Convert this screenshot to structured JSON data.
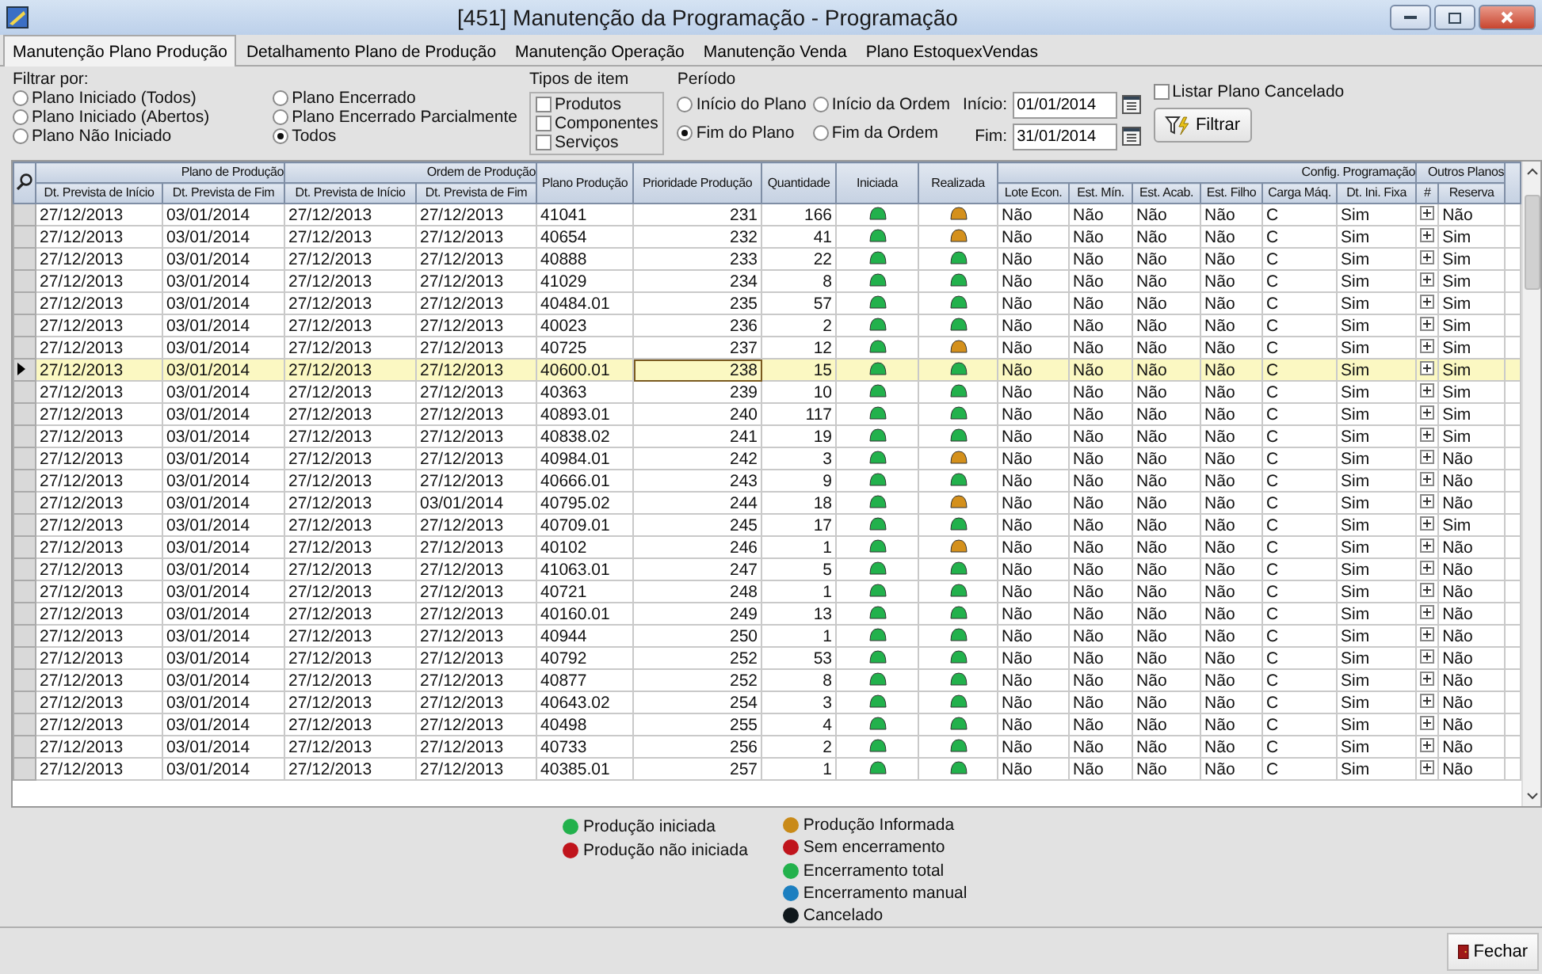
{
  "window": {
    "title": "[451] Manutenção da Programação - Programação"
  },
  "tabs": [
    {
      "label": "Manutenção Plano Produção",
      "selected": true
    },
    {
      "label": "Detalhamento Plano de Produção",
      "selected": false
    },
    {
      "label": "Manutenção Operação",
      "selected": false
    },
    {
      "label": "Manutenção Venda",
      "selected": false
    },
    {
      "label": "Plano EstoquexVendas",
      "selected": false
    }
  ],
  "filter": {
    "label": "Filtrar por:",
    "options": [
      {
        "label": "Plano Iniciado (Todos)",
        "selected": false
      },
      {
        "label": "Plano Iniciado (Abertos)",
        "selected": false
      },
      {
        "label": "Plano Não Iniciado",
        "selected": false
      },
      {
        "label": "Plano Encerrado",
        "selected": false
      },
      {
        "label": "Plano Encerrado Parcialmente",
        "selected": false
      },
      {
        "label": "Todos",
        "selected": true
      }
    ]
  },
  "item_types": {
    "label": "Tipos de item",
    "items": [
      {
        "label": "Produtos",
        "checked": false
      },
      {
        "label": "Componentes",
        "checked": false
      },
      {
        "label": "Serviços",
        "checked": false
      }
    ]
  },
  "period": {
    "label": "Período",
    "options": [
      {
        "label": "Início do Plano",
        "selected": false
      },
      {
        "label": "Início da Ordem",
        "selected": false
      },
      {
        "label": "Fim do Plano",
        "selected": true
      },
      {
        "label": "Fim da Ordem",
        "selected": false
      }
    ]
  },
  "start": {
    "label": "Início:",
    "value": "01/01/2014"
  },
  "end": {
    "label": "Fim:",
    "value": "31/01/2014"
  },
  "list_cancelled": {
    "label": "Listar Plano Cancelado",
    "checked": false
  },
  "filter_button": "Filtrar",
  "table": {
    "header": [
      {
        "label": "Plano de Produção",
        "columns": [
          "Dt. Prevista de Início",
          "Dt. Prevista de Fim"
        ]
      },
      {
        "label": "Ordem de Produção",
        "columns": [
          "Dt. Prevista de Início",
          "Dt. Prevista de Fim"
        ]
      },
      {
        "label": "Plano Produção"
      },
      {
        "label": "Prioridade Produção"
      },
      {
        "label": "Quantidade"
      },
      {
        "label": "Iniciada"
      },
      {
        "label": "Realizada"
      },
      {
        "label": "Config. Programação",
        "columns": [
          "Lote Econ.",
          "Est. Mín.",
          "Est. Acab.",
          "Est. Filho",
          "Carga Máq.",
          "Dt. Ini. Fixa"
        ]
      },
      {
        "label": "Outros Planos",
        "columns": [
          "#",
          "Reserva"
        ]
      }
    ],
    "rows": [
      {
        "selected": false,
        "cells": [
          "27/12/2013",
          "03/01/2014",
          "27/12/2013",
          "27/12/2013",
          "41041",
          "231",
          "166"
        ],
        "iniciada": {
          "color": "#22b14c"
        },
        "realizada": {
          "color": "#d4901c"
        },
        "config": [
          "Não",
          "Não",
          "Não",
          "Não",
          "C",
          "Sim"
        ],
        "reserva": "Não"
      },
      {
        "selected": false,
        "cells": [
          "27/12/2013",
          "03/01/2014",
          "27/12/2013",
          "27/12/2013",
          "40654",
          "232",
          "41"
        ],
        "iniciada": {
          "color": "#22b14c"
        },
        "realizada": {
          "color": "#d4901c"
        },
        "config": [
          "Não",
          "Não",
          "Não",
          "Não",
          "C",
          "Sim"
        ],
        "reserva": "Sim"
      },
      {
        "selected": false,
        "cells": [
          "27/12/2013",
          "03/01/2014",
          "27/12/2013",
          "27/12/2013",
          "40888",
          "233",
          "22"
        ],
        "iniciada": {
          "color": "#22b14c"
        },
        "realizada": {
          "color": "#22b14c"
        },
        "config": [
          "Não",
          "Não",
          "Não",
          "Não",
          "C",
          "Sim"
        ],
        "reserva": "Sim"
      },
      {
        "selected": false,
        "cells": [
          "27/12/2013",
          "03/01/2014",
          "27/12/2013",
          "27/12/2013",
          "41029",
          "234",
          "8"
        ],
        "iniciada": {
          "color": "#22b14c"
        },
        "realizada": {
          "color": "#22b14c"
        },
        "config": [
          "Não",
          "Não",
          "Não",
          "Não",
          "C",
          "Sim"
        ],
        "reserva": "Sim"
      },
      {
        "selected": false,
        "cells": [
          "27/12/2013",
          "03/01/2014",
          "27/12/2013",
          "27/12/2013",
          "40484.01",
          "235",
          "57"
        ],
        "iniciada": {
          "color": "#22b14c"
        },
        "realizada": {
          "color": "#22b14c"
        },
        "config": [
          "Não",
          "Não",
          "Não",
          "Não",
          "C",
          "Sim"
        ],
        "reserva": "Sim"
      },
      {
        "selected": false,
        "cells": [
          "27/12/2013",
          "03/01/2014",
          "27/12/2013",
          "27/12/2013",
          "40023",
          "236",
          "2"
        ],
        "iniciada": {
          "color": "#22b14c"
        },
        "realizada": {
          "color": "#22b14c"
        },
        "config": [
          "Não",
          "Não",
          "Não",
          "Não",
          "C",
          "Sim"
        ],
        "reserva": "Sim"
      },
      {
        "selected": false,
        "cells": [
          "27/12/2013",
          "03/01/2014",
          "27/12/2013",
          "27/12/2013",
          "40725",
          "237",
          "12"
        ],
        "iniciada": {
          "color": "#22b14c"
        },
        "realizada": {
          "color": "#d4901c"
        },
        "config": [
          "Não",
          "Não",
          "Não",
          "Não",
          "C",
          "Sim"
        ],
        "reserva": "Sim"
      },
      {
        "selected": true,
        "cells": [
          "27/12/2013",
          "03/01/2014",
          "27/12/2013",
          "27/12/2013",
          "40600.01",
          "238",
          "15"
        ],
        "iniciada": {
          "color": "#22b14c"
        },
        "realizada": {
          "color": "#22b14c"
        },
        "config": [
          "Não",
          "Não",
          "Não",
          "Não",
          "C",
          "Sim"
        ],
        "reserva": "Sim"
      },
      {
        "selected": false,
        "cells": [
          "27/12/2013",
          "03/01/2014",
          "27/12/2013",
          "27/12/2013",
          "40363",
          "239",
          "10"
        ],
        "iniciada": {
          "color": "#22b14c"
        },
        "realizada": {
          "color": "#22b14c"
        },
        "config": [
          "Não",
          "Não",
          "Não",
          "Não",
          "C",
          "Sim"
        ],
        "reserva": "Sim"
      },
      {
        "selected": false,
        "cells": [
          "27/12/2013",
          "03/01/2014",
          "27/12/2013",
          "27/12/2013",
          "40893.01",
          "240",
          "117"
        ],
        "iniciada": {
          "color": "#22b14c"
        },
        "realizada": {
          "color": "#22b14c"
        },
        "config": [
          "Não",
          "Não",
          "Não",
          "Não",
          "C",
          "Sim"
        ],
        "reserva": "Sim"
      },
      {
        "selected": false,
        "cells": [
          "27/12/2013",
          "03/01/2014",
          "27/12/2013",
          "27/12/2013",
          "40838.02",
          "241",
          "19"
        ],
        "iniciada": {
          "color": "#22b14c"
        },
        "realizada": {
          "color": "#22b14c"
        },
        "config": [
          "Não",
          "Não",
          "Não",
          "Não",
          "C",
          "Sim"
        ],
        "reserva": "Sim"
      },
      {
        "selected": false,
        "cells": [
          "27/12/2013",
          "03/01/2014",
          "27/12/2013",
          "27/12/2013",
          "40984.01",
          "242",
          "3"
        ],
        "iniciada": {
          "color": "#22b14c"
        },
        "realizada": {
          "color": "#d4901c"
        },
        "config": [
          "Não",
          "Não",
          "Não",
          "Não",
          "C",
          "Sim"
        ],
        "reserva": "Não"
      },
      {
        "selected": false,
        "cells": [
          "27/12/2013",
          "03/01/2014",
          "27/12/2013",
          "27/12/2013",
          "40666.01",
          "243",
          "9"
        ],
        "iniciada": {
          "color": "#22b14c"
        },
        "realizada": {
          "color": "#22b14c"
        },
        "config": [
          "Não",
          "Não",
          "Não",
          "Não",
          "C",
          "Sim"
        ],
        "reserva": "Não"
      },
      {
        "selected": false,
        "cells": [
          "27/12/2013",
          "03/01/2014",
          "27/12/2013",
          "03/01/2014",
          "40795.02",
          "244",
          "18"
        ],
        "iniciada": {
          "color": "#22b14c"
        },
        "realizada": {
          "color": "#d4901c"
        },
        "config": [
          "Não",
          "Não",
          "Não",
          "Não",
          "C",
          "Sim"
        ],
        "reserva": "Não"
      },
      {
        "selected": false,
        "cells": [
          "27/12/2013",
          "03/01/2014",
          "27/12/2013",
          "27/12/2013",
          "40709.01",
          "245",
          "17"
        ],
        "iniciada": {
          "color": "#22b14c"
        },
        "realizada": {
          "color": "#22b14c"
        },
        "config": [
          "Não",
          "Não",
          "Não",
          "Não",
          "C",
          "Sim"
        ],
        "reserva": "Sim"
      },
      {
        "selected": false,
        "cells": [
          "27/12/2013",
          "03/01/2014",
          "27/12/2013",
          "27/12/2013",
          "40102",
          "246",
          "1"
        ],
        "iniciada": {
          "color": "#22b14c"
        },
        "realizada": {
          "color": "#d4901c"
        },
        "config": [
          "Não",
          "Não",
          "Não",
          "Não",
          "C",
          "Sim"
        ],
        "reserva": "Não"
      },
      {
        "selected": false,
        "cells": [
          "27/12/2013",
          "03/01/2014",
          "27/12/2013",
          "27/12/2013",
          "41063.01",
          "247",
          "5"
        ],
        "iniciada": {
          "color": "#22b14c"
        },
        "realizada": {
          "color": "#22b14c"
        },
        "config": [
          "Não",
          "Não",
          "Não",
          "Não",
          "C",
          "Sim"
        ],
        "reserva": "Não"
      },
      {
        "selected": false,
        "cells": [
          "27/12/2013",
          "03/01/2014",
          "27/12/2013",
          "27/12/2013",
          "40721",
          "248",
          "1"
        ],
        "iniciada": {
          "color": "#22b14c"
        },
        "realizada": {
          "color": "#22b14c"
        },
        "config": [
          "Não",
          "Não",
          "Não",
          "Não",
          "C",
          "Sim"
        ],
        "reserva": "Não"
      },
      {
        "selected": false,
        "cells": [
          "27/12/2013",
          "03/01/2014",
          "27/12/2013",
          "27/12/2013",
          "40160.01",
          "249",
          "13"
        ],
        "iniciada": {
          "color": "#22b14c"
        },
        "realizada": {
          "color": "#22b14c"
        },
        "config": [
          "Não",
          "Não",
          "Não",
          "Não",
          "C",
          "Sim"
        ],
        "reserva": "Não"
      },
      {
        "selected": false,
        "cells": [
          "27/12/2013",
          "03/01/2014",
          "27/12/2013",
          "27/12/2013",
          "40944",
          "250",
          "1"
        ],
        "iniciada": {
          "color": "#22b14c"
        },
        "realizada": {
          "color": "#22b14c"
        },
        "config": [
          "Não",
          "Não",
          "Não",
          "Não",
          "C",
          "Sim"
        ],
        "reserva": "Não"
      },
      {
        "selected": false,
        "cells": [
          "27/12/2013",
          "03/01/2014",
          "27/12/2013",
          "27/12/2013",
          "40792",
          "252",
          "53"
        ],
        "iniciada": {
          "color": "#22b14c"
        },
        "realizada": {
          "color": "#22b14c"
        },
        "config": [
          "Não",
          "Não",
          "Não",
          "Não",
          "C",
          "Sim"
        ],
        "reserva": "Não"
      },
      {
        "selected": false,
        "cells": [
          "27/12/2013",
          "03/01/2014",
          "27/12/2013",
          "27/12/2013",
          "40877",
          "252",
          "8"
        ],
        "iniciada": {
          "color": "#22b14c"
        },
        "realizada": {
          "color": "#22b14c"
        },
        "config": [
          "Não",
          "Não",
          "Não",
          "Não",
          "C",
          "Sim"
        ],
        "reserva": "Não"
      },
      {
        "selected": false,
        "cells": [
          "27/12/2013",
          "03/01/2014",
          "27/12/2013",
          "27/12/2013",
          "40643.02",
          "254",
          "3"
        ],
        "iniciada": {
          "color": "#22b14c"
        },
        "realizada": {
          "color": "#22b14c"
        },
        "config": [
          "Não",
          "Não",
          "Não",
          "Não",
          "C",
          "Sim"
        ],
        "reserva": "Não"
      },
      {
        "selected": false,
        "cells": [
          "27/12/2013",
          "03/01/2014",
          "27/12/2013",
          "27/12/2013",
          "40498",
          "255",
          "4"
        ],
        "iniciada": {
          "color": "#22b14c"
        },
        "realizada": {
          "color": "#22b14c"
        },
        "config": [
          "Não",
          "Não",
          "Não",
          "Não",
          "C",
          "Sim"
        ],
        "reserva": "Não"
      },
      {
        "selected": false,
        "cells": [
          "27/12/2013",
          "03/01/2014",
          "27/12/2013",
          "27/12/2013",
          "40733",
          "256",
          "2"
        ],
        "iniciada": {
          "color": "#22b14c"
        },
        "realizada": {
          "color": "#22b14c"
        },
        "config": [
          "Não",
          "Não",
          "Não",
          "Não",
          "C",
          "Sim"
        ],
        "reserva": "Não"
      },
      {
        "selected": false,
        "cells": [
          "27/12/2013",
          "03/01/2014",
          "27/12/2013",
          "27/12/2013",
          "40385.01",
          "257",
          "1"
        ],
        "iniciada": {
          "color": "#22b14c"
        },
        "realizada": {
          "color": "#22b14c"
        },
        "config": [
          "Não",
          "Não",
          "Não",
          "Não",
          "C",
          "Sim"
        ],
        "reserva": "Não"
      }
    ]
  },
  "legend": [
    {
      "items": [
        {
          "label": "Produção iniciada",
          "color": "#22b14c"
        },
        {
          "label": "Produção não iniciada",
          "color": "#c0141c"
        }
      ]
    },
    {
      "items": [
        {
          "label": "Produção Informada",
          "color": "#c98a18"
        },
        {
          "label": "Sem encerramento",
          "color": "#c0141c"
        },
        {
          "label": "Encerramento total",
          "color": "#22b14c"
        },
        {
          "label": "Encerramento manual",
          "color": "#1c7fc0"
        },
        {
          "label": "Cancelado",
          "color": "#10181c"
        }
      ]
    }
  ],
  "close_button": "Fechar"
}
